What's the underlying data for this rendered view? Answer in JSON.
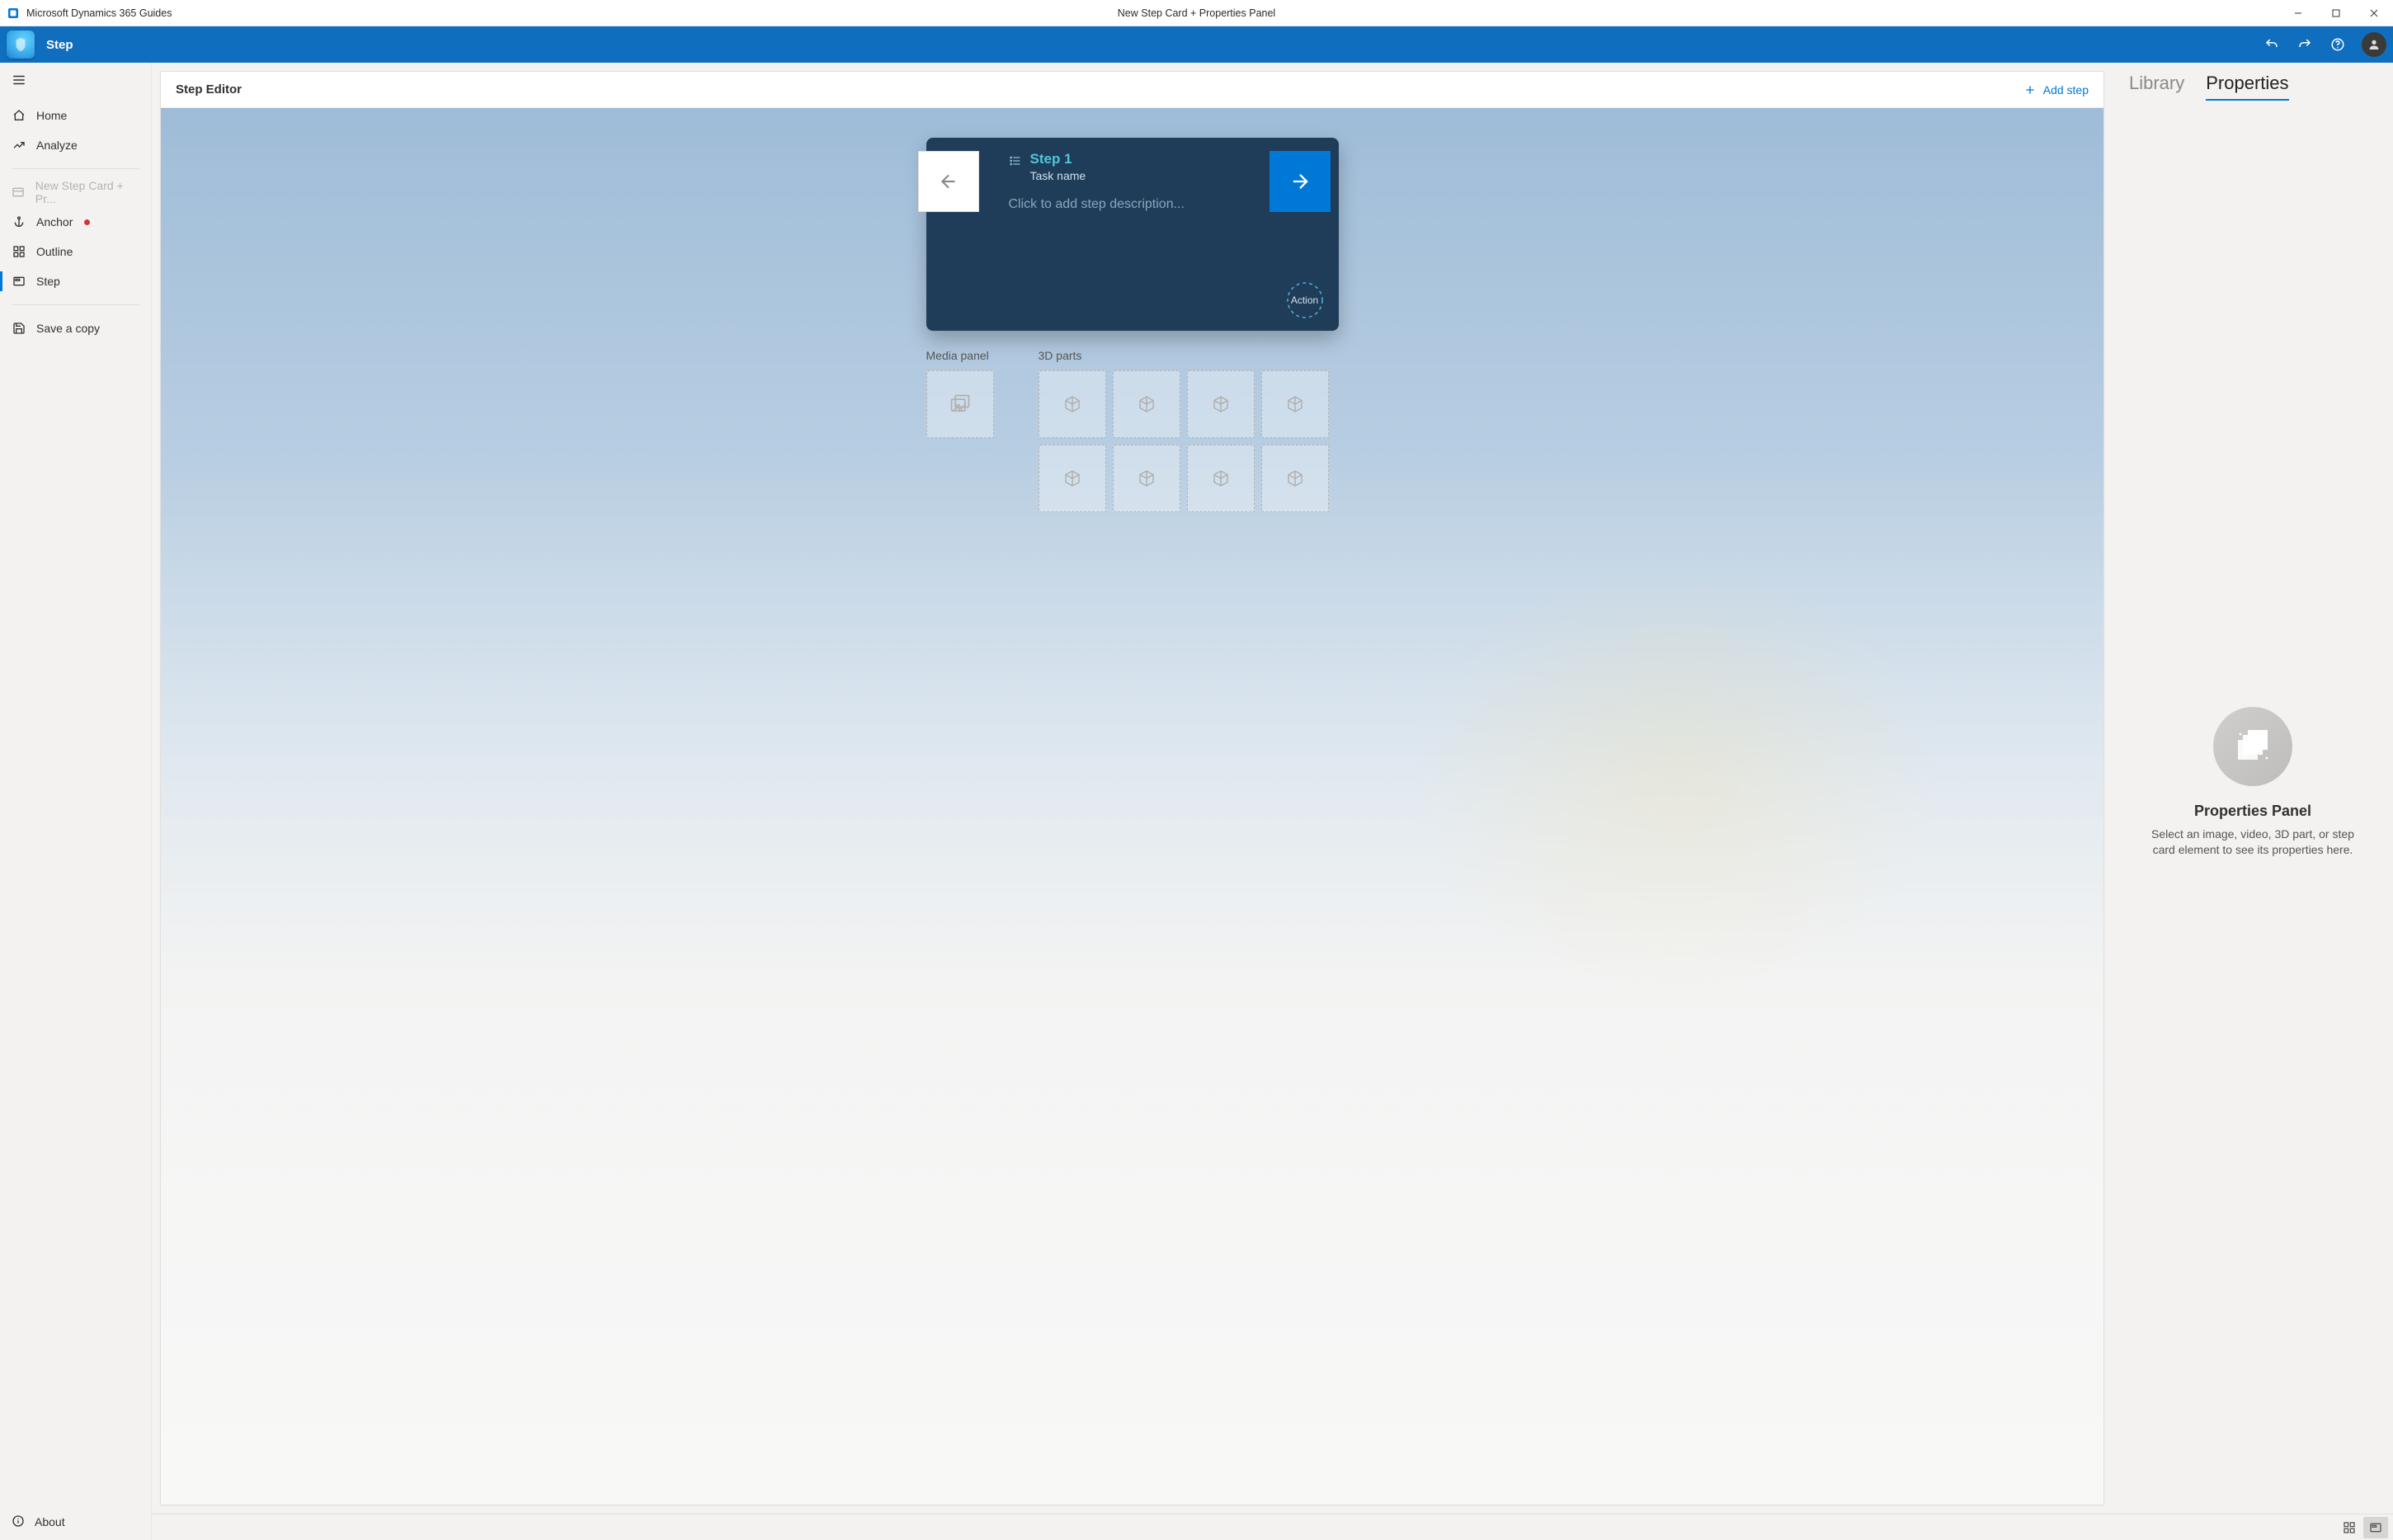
{
  "window": {
    "app_name": "Microsoft Dynamics 365 Guides",
    "document_title": "New Step Card + Properties Panel"
  },
  "topbar": {
    "title": "Step"
  },
  "sidebar": {
    "items": [
      {
        "id": "home",
        "label": "Home"
      },
      {
        "id": "analyze",
        "label": "Analyze"
      },
      {
        "id": "doctab",
        "label": "New Step Card + Pr...",
        "disabled": true
      },
      {
        "id": "anchor",
        "label": "Anchor",
        "warning": true
      },
      {
        "id": "outline",
        "label": "Outline"
      },
      {
        "id": "step",
        "label": "Step",
        "active": true
      },
      {
        "id": "savecopy",
        "label": "Save a copy"
      }
    ],
    "about": "About"
  },
  "editor": {
    "header": "Step Editor",
    "add_step": "Add step",
    "step_card": {
      "title": "Step 1",
      "task": "Task name",
      "description_placeholder": "Click to add step description...",
      "action_label": "Action"
    },
    "panels": {
      "media_label": "Media panel",
      "parts_label": "3D parts",
      "parts_slots": 8
    }
  },
  "right_pane": {
    "tabs": {
      "library": "Library",
      "properties": "Properties",
      "active": "properties"
    },
    "empty": {
      "title": "Properties Panel",
      "body": "Select an image, video, 3D part, or step card element to see its properties here."
    }
  }
}
